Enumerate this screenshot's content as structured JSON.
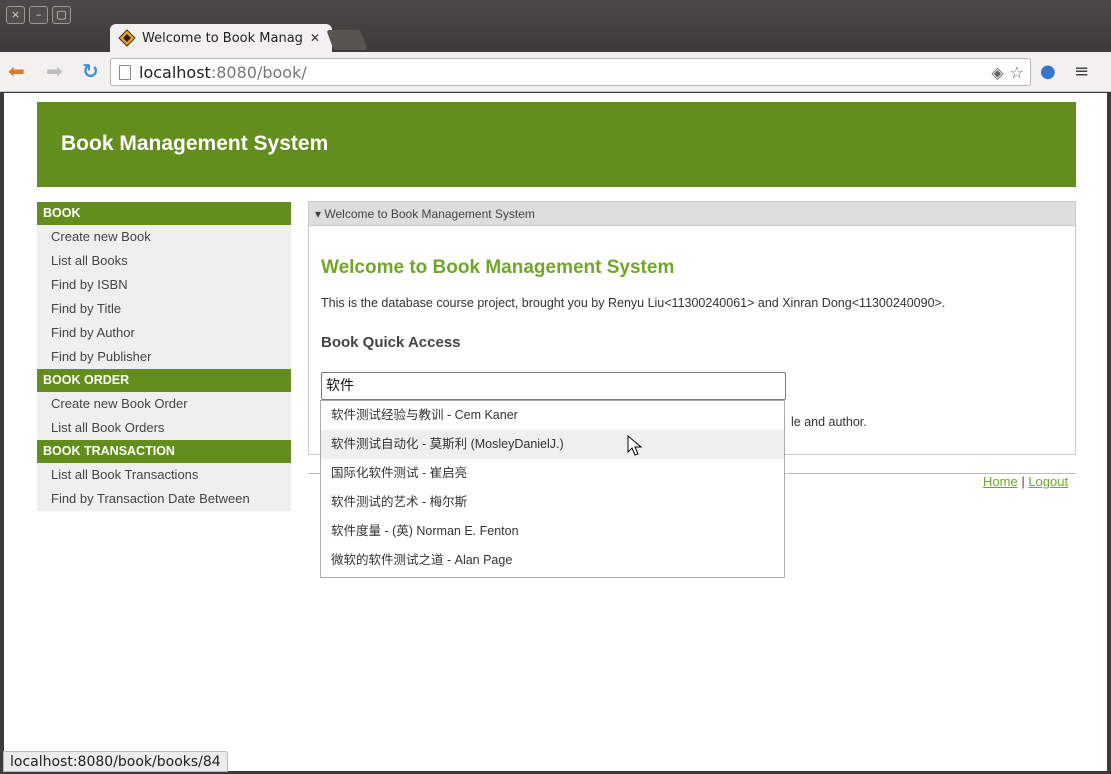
{
  "browser": {
    "tab_title": "Welcome to Book Manage",
    "url_host": "localhost",
    "url_path": ":8080/book/",
    "status_url": "localhost:8080/book/books/84"
  },
  "site": {
    "title": "Book Management System"
  },
  "sidebar": {
    "groups": [
      {
        "heading": "BOOK",
        "items": [
          "Create new Book",
          "List all Books",
          "Find by ISBN",
          "Find by Title",
          "Find by Author",
          "Find by Publisher"
        ]
      },
      {
        "heading": "BOOK ORDER",
        "items": [
          "Create new Book Order",
          "List all Book Orders"
        ]
      },
      {
        "heading": "BOOK TRANSACTION",
        "items": [
          "List all Book Transactions",
          "Find by Transaction Date Between"
        ]
      }
    ]
  },
  "panel": {
    "header": "Welcome to Book Management System",
    "title": "Welcome to Book Management System",
    "intro": "This is the database course project, brought you by Renyu Liu<11300240061> and Xinran Dong<11300240090>.",
    "subtitle": "Book Quick Access",
    "search_value": "软件",
    "hint_tail": "le and author."
  },
  "autocomplete": [
    "软件测试经验与教训 - Cem Kaner",
    "软件测试自动化 - 莫斯利 (MosleyDanielJ.)",
    "国际化软件测试 - 崔启亮",
    "软件测试的艺术 - 梅尔斯",
    "软件度量 - (英) Norman E. Fenton",
    "微软的软件测试之道 - Alan Page"
  ],
  "autocomplete_hover_index": 1,
  "footer": {
    "home": "Home",
    "separator": "|",
    "logout": "Logout"
  },
  "colors": {
    "brand_green": "#638d1c",
    "title_green": "#72a62a"
  }
}
